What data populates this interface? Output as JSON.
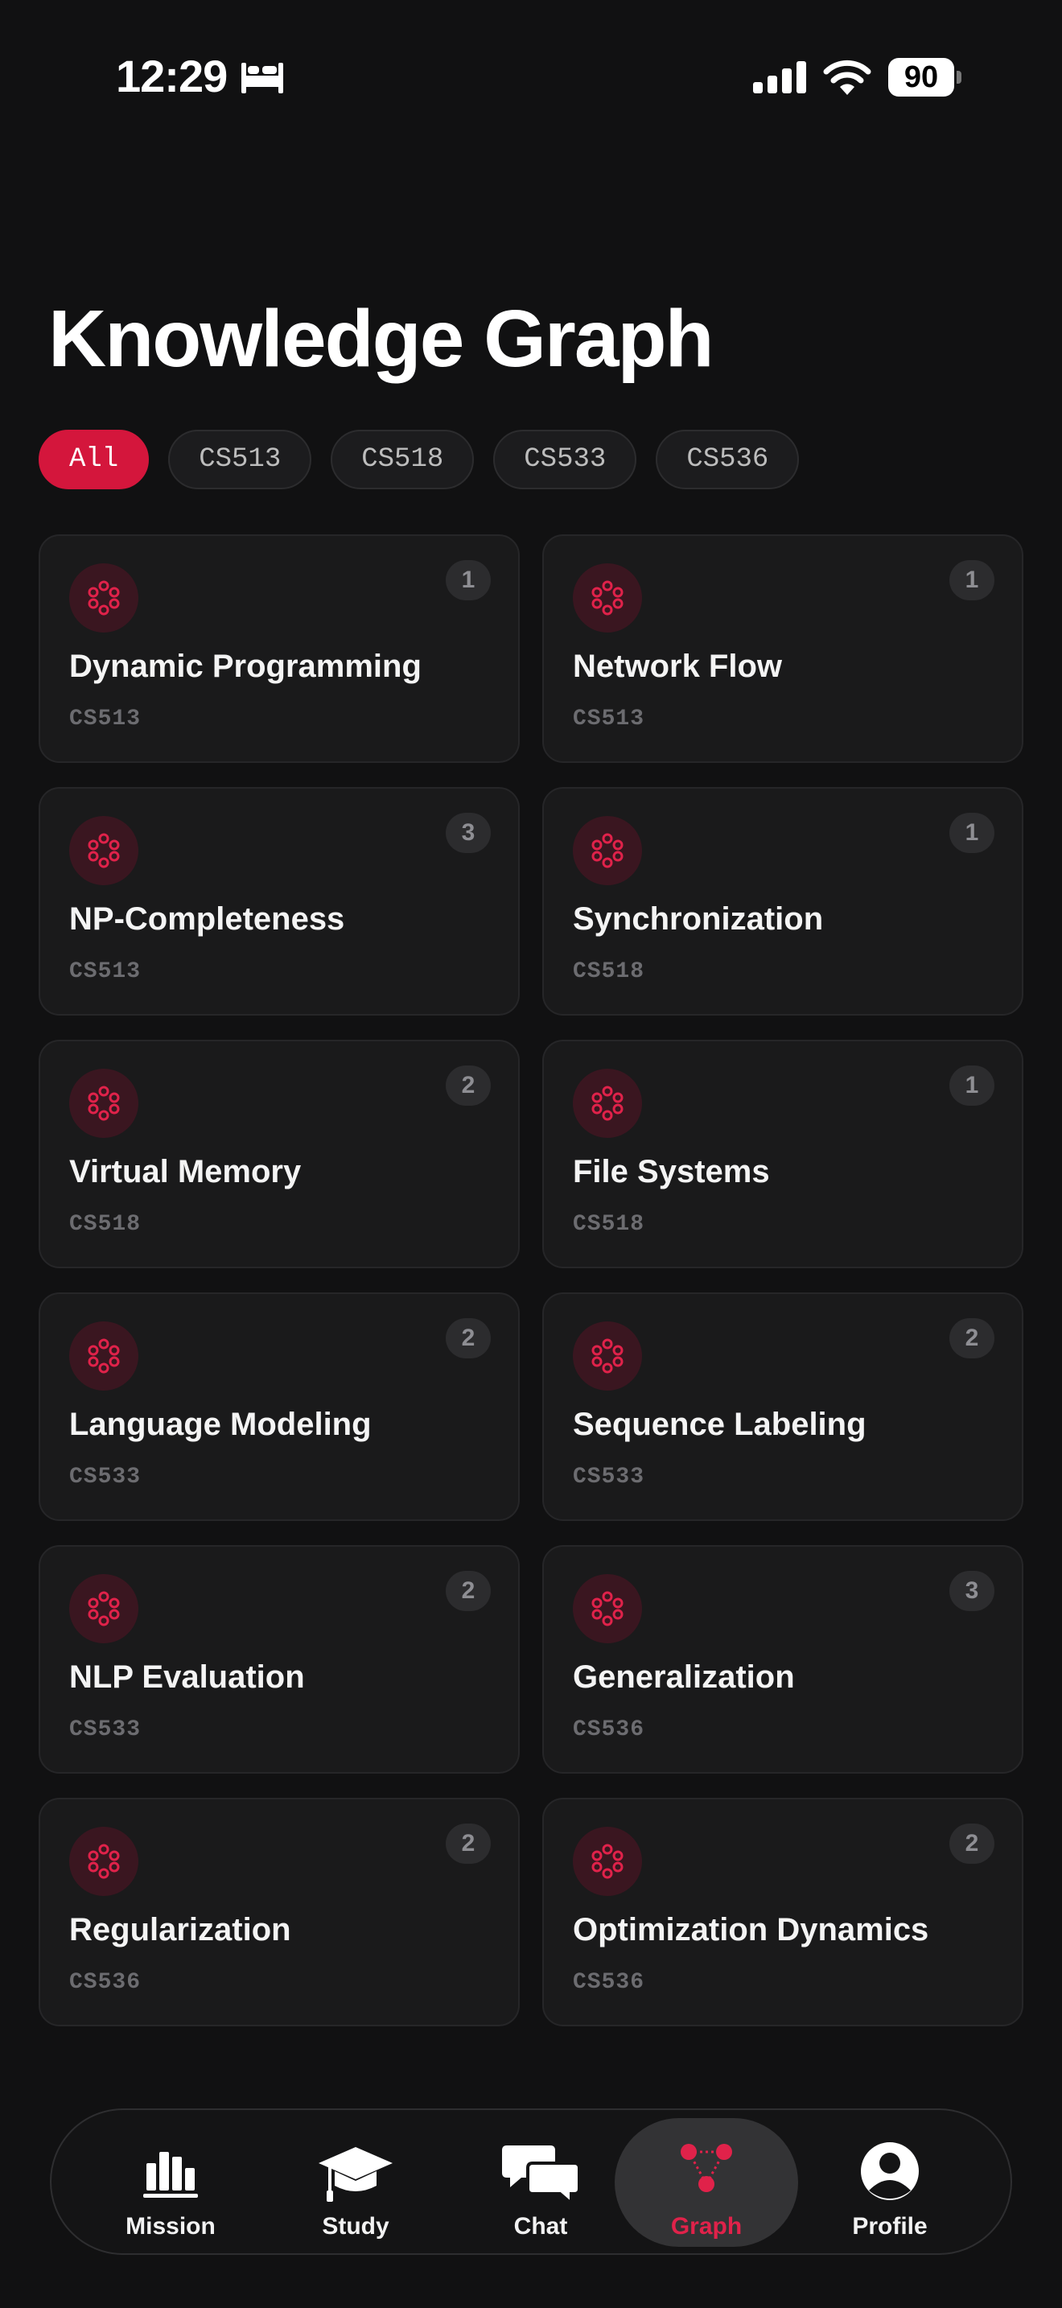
{
  "status_bar": {
    "time": "12:29",
    "battery": "90"
  },
  "page_title": "Knowledge Graph",
  "filters": [
    {
      "label": "All",
      "active": true
    },
    {
      "label": "CS513",
      "active": false
    },
    {
      "label": "CS518",
      "active": false
    },
    {
      "label": "CS533",
      "active": false
    },
    {
      "label": "CS536",
      "active": false
    }
  ],
  "topics": [
    {
      "title": "Dynamic Programming",
      "course": "CS513",
      "count": "1"
    },
    {
      "title": "Network Flow",
      "course": "CS513",
      "count": "1"
    },
    {
      "title": "NP-Completeness",
      "course": "CS513",
      "count": "3"
    },
    {
      "title": "Synchronization",
      "course": "CS518",
      "count": "1"
    },
    {
      "title": "Virtual Memory",
      "course": "CS518",
      "count": "2"
    },
    {
      "title": "File Systems",
      "course": "CS518",
      "count": "1"
    },
    {
      "title": "Language Modeling",
      "course": "CS533",
      "count": "2"
    },
    {
      "title": "Sequence Labeling",
      "course": "CS533",
      "count": "2"
    },
    {
      "title": "NLP Evaluation",
      "course": "CS533",
      "count": "2"
    },
    {
      "title": "Generalization",
      "course": "CS536",
      "count": "3"
    },
    {
      "title": "Regularization",
      "course": "CS536",
      "count": "2"
    },
    {
      "title": "Optimization Dynamics",
      "course": "CS536",
      "count": "2"
    }
  ],
  "tabs": [
    {
      "label": "Mission",
      "icon": "bar-chart-icon",
      "active": false
    },
    {
      "label": "Study",
      "icon": "graduation-cap-icon",
      "active": false
    },
    {
      "label": "Chat",
      "icon": "chat-bubbles-icon",
      "active": false
    },
    {
      "label": "Graph",
      "icon": "graph-nodes-icon",
      "active": true
    },
    {
      "label": "Profile",
      "icon": "person-circle-icon",
      "active": false
    }
  ],
  "colors": {
    "accent": "#d4163c",
    "background": "#111112",
    "card": "#1a1a1b"
  }
}
